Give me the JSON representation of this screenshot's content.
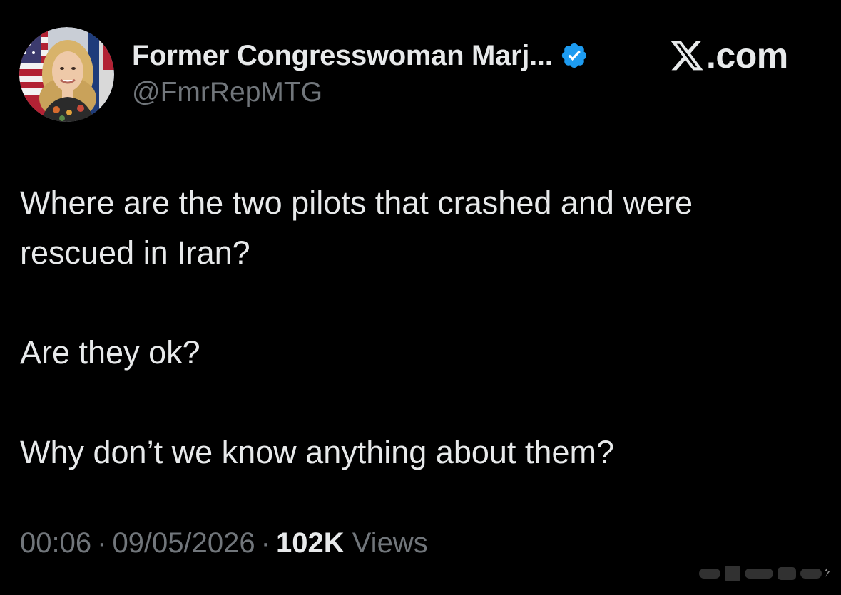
{
  "author": {
    "display_name": "Former Congresswoman Marj...",
    "handle": "@FmrRepMTG",
    "verified": true
  },
  "brand": {
    "text": ".com",
    "icon": "x-logo-icon"
  },
  "tweet": {
    "paragraphs": [
      "Where are the two pilots that crashed and were rescued in Iran?",
      "Are they ok?",
      "Why don’t we know anything about them?"
    ]
  },
  "meta": {
    "time": "00:06",
    "separator": "·",
    "date": "09/05/2026",
    "views_count": "102K",
    "views_label": "Views"
  },
  "colors": {
    "background": "#000000",
    "primary_text": "#e7e9ea",
    "secondary_text": "#71767b",
    "verified_blue": "#1d9bf0"
  }
}
